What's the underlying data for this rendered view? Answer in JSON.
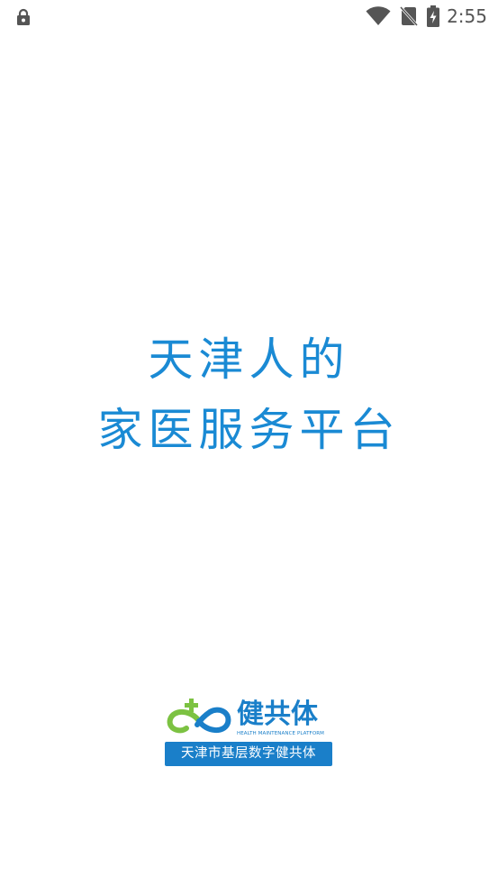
{
  "status_bar": {
    "time": "2:55",
    "icons": [
      "lock-icon",
      "wifi-icon",
      "no-sim-icon",
      "battery-charging-icon"
    ],
    "icon_color": "#555555"
  },
  "slogan": {
    "line1": "天津人的",
    "line2": "家医服务平台",
    "color": "#1a8ad4"
  },
  "logo": {
    "name": "健共体",
    "subtitle": "HEALTH MAINTENANCE PLATFORM",
    "banner": "天津市基层数字健共体",
    "colors": {
      "blue": "#1a7fc9",
      "green": "#7cc242"
    }
  }
}
